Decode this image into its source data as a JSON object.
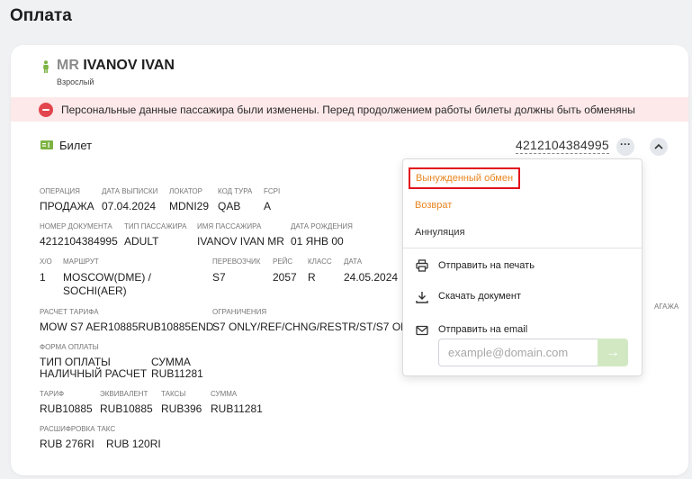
{
  "page": {
    "title": "Оплата"
  },
  "passenger": {
    "title": "MR",
    "name": "IVANOV IVAN",
    "type": "Взрослый"
  },
  "alert": {
    "text": "Персональные данные пассажира были изменены. Перед продолжением работы билеты должны быть обменяны"
  },
  "ticket": {
    "label": "Билет",
    "number": "4212104384995",
    "more": "···"
  },
  "details": {
    "operation_label": "ОПЕРАЦИЯ",
    "operation": "ПРОДАЖА",
    "issue_date_label": "ДАТА ВЫПИСКИ",
    "issue_date": "07.04.2024",
    "locator_label": "ЛОКАТОР",
    "locator": "MDNI29",
    "tour_code_label": "КОД ТУРА",
    "tour_code": "QAB",
    "fcpi_label": "FCPI",
    "fcpi": "A",
    "doc_number_label": "НОМЕР ДОКУМЕНТА",
    "doc_number": "4212104384995",
    "pax_type_label": "ТИП ПАССАЖИРА",
    "pax_type": "ADULT",
    "pax_name_label": "ИМЯ ПАССАЖИРА",
    "pax_name": "IVANOV IVAN MR",
    "birth_date_label": "ДАТА РОЖДЕНИЯ",
    "birth_date": "01 ЯНВ 00",
    "xo_label": "Х/О",
    "xo": "1",
    "route_label": "МАРШРУТ",
    "route_line1": "MOSCOW(DME) /",
    "route_line2": "SOCHI(AER)",
    "carrier_label": "ПЕРЕВОЗЧИК",
    "carrier": "S7",
    "flight_label": "РЕЙС",
    "flight": "2057",
    "class_label": "КЛАСС",
    "class": "R",
    "date_label": "ДАТА",
    "date": "24.05.2024",
    "baggage_label_partial": "АГАЖА",
    "fare_calc_label": "РАСЧЕТ ТАРИФА",
    "fare_calc": "MOW S7 AER10885RUB10885END",
    "restrictions_label": "ОГРАНИЧЕНИЯ",
    "restrictions": "S7 ONLY/REF/CHNG/RESTR/ST/S7 ONLY",
    "payment_form_label": "ФОРМА ОПЛАТЫ",
    "pay_type_header": "ТИП ОПЛАТЫ",
    "pay_sum_header": "СУММА",
    "pay_type": "НАЛИЧНЫЙ РАСЧЕТ",
    "pay_sum": "RUB11281",
    "fare_label": "ТАРИФ",
    "fare": "RUB10885",
    "equiv_label": "ЭКВИВАЛЕНТ",
    "equiv": "RUB10885",
    "taxes_label": "ТАКСЫ",
    "taxes": "RUB396",
    "sum_label": "СУММА",
    "sum": "RUB11281",
    "tax_breakdown_label": "РАСШИФРОВКА ТАКС",
    "tax_breakdown": "RUB 276RI    RUB 120RI"
  },
  "menu": {
    "forced_exchange": "Вынужденный обмен",
    "refund": "Возврат",
    "void": "Аннуляция",
    "print": "Отправить на печать",
    "download": "Скачать документ",
    "email": "Отправить на email",
    "email_placeholder": "example@domain.com",
    "send_arrow": "→"
  },
  "colors": {
    "accent_orange": "#e98621",
    "alert_bg": "#fde9ea",
    "alert_icon": "#e2454d",
    "highlight_border": "#e3121b",
    "send_button": "#d2e8c2",
    "person_icon": "#7cb342"
  }
}
